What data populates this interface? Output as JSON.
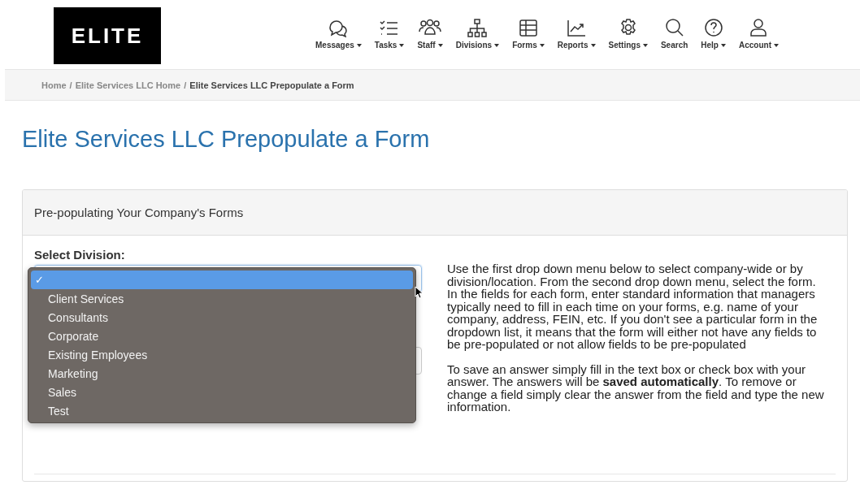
{
  "logo": {
    "text": "ELITE"
  },
  "nav": [
    {
      "label": "Messages",
      "kind": "messages",
      "caret": true
    },
    {
      "label": "Tasks",
      "kind": "tasks",
      "caret": true
    },
    {
      "label": "Staff",
      "kind": "staff",
      "caret": true
    },
    {
      "label": "Divisions",
      "kind": "divisions",
      "caret": true
    },
    {
      "label": "Forms",
      "kind": "forms",
      "caret": true
    },
    {
      "label": "Reports",
      "kind": "reports",
      "caret": true
    },
    {
      "label": "Settings",
      "kind": "settings",
      "caret": true
    },
    {
      "label": "Search",
      "kind": "search",
      "caret": false
    },
    {
      "label": "Help",
      "kind": "help",
      "caret": true
    },
    {
      "label": "Account",
      "kind": "account",
      "caret": true
    }
  ],
  "breadcrumb": [
    {
      "label": "Home",
      "current": false
    },
    {
      "label": "Elite Services LLC Home",
      "current": false
    },
    {
      "label": "Elite Services LLC Prepopulate a Form",
      "current": true
    }
  ],
  "breadcrumb_separator": "/",
  "page_title": "Elite Services LLC Prepopulate a Form",
  "panel": {
    "heading": "Pre-populating Your Company's Forms",
    "division_label": "Select Division:",
    "division_menu": [
      {
        "selected": true
      },
      {
        "label": "Client Services",
        "selected": false
      },
      {
        "label": "Consultants",
        "selected": false
      },
      {
        "label": "Corporate",
        "selected": false
      },
      {
        "label": "Existing Employees",
        "selected": false
      },
      {
        "label": "Marketing",
        "selected": false
      },
      {
        "label": "Sales",
        "selected": false
      },
      {
        "label": "Test",
        "selected": false
      }
    ],
    "check_mark": "✓",
    "instructions": [
      "Use the first drop down menu below to select company-wide or by division/location. From the second drop down menu, select the form. In the fields for each form, enter standard information that managers typically need to fill in each time on your forms, e.g. name of your company, address, FEIN, etc. If you don't see a particular form in the dropdown list, it means that the form will either not have any fields to be pre-populated or not allow fields to be pre-populated",
      "To save an answer simply fill in the text box or check box with your answer. The answers will be **saved automatically**. To remove or change a field simply clear the answer from the field and type the new information."
    ]
  }
}
